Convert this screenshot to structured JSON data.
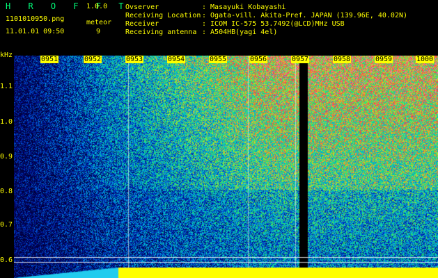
{
  "header": {
    "logo": "H R O F F T",
    "version": "1.0.0",
    "filename": "1101010950.png",
    "datetime": "11.01.01 09:50",
    "meteor_label": "meteor",
    "meteor_count": "9"
  },
  "info": {
    "observer_label": "Ovserver",
    "observer_value": ": Masayuki Kobayashi",
    "location_label": "Receiving Location",
    "location_value": ": Ogata-vill. Akita-Pref. JAPAN (139.96E, 40.02N)",
    "receiver_label": "Receiver",
    "receiver_value": ": ICOM IC-575 53.7492(@LCD)MHz USB",
    "antenna_label": "Receiving antenna",
    "antenna_value": ": A504HB(yagi 4el)"
  },
  "axis": {
    "unit": "kHz",
    "freq_ticks": [
      "1.1",
      "1.0",
      "0.9",
      "0.8",
      "0.7",
      "0.6"
    ],
    "time_ticks": [
      "0951",
      "0952",
      "0953",
      "0954",
      "0955",
      "0956",
      "0957",
      "0958",
      "0959",
      "1000"
    ]
  },
  "colors": {
    "text": "#ffff00",
    "logo": "#00ff7a",
    "background": "#000000"
  }
}
